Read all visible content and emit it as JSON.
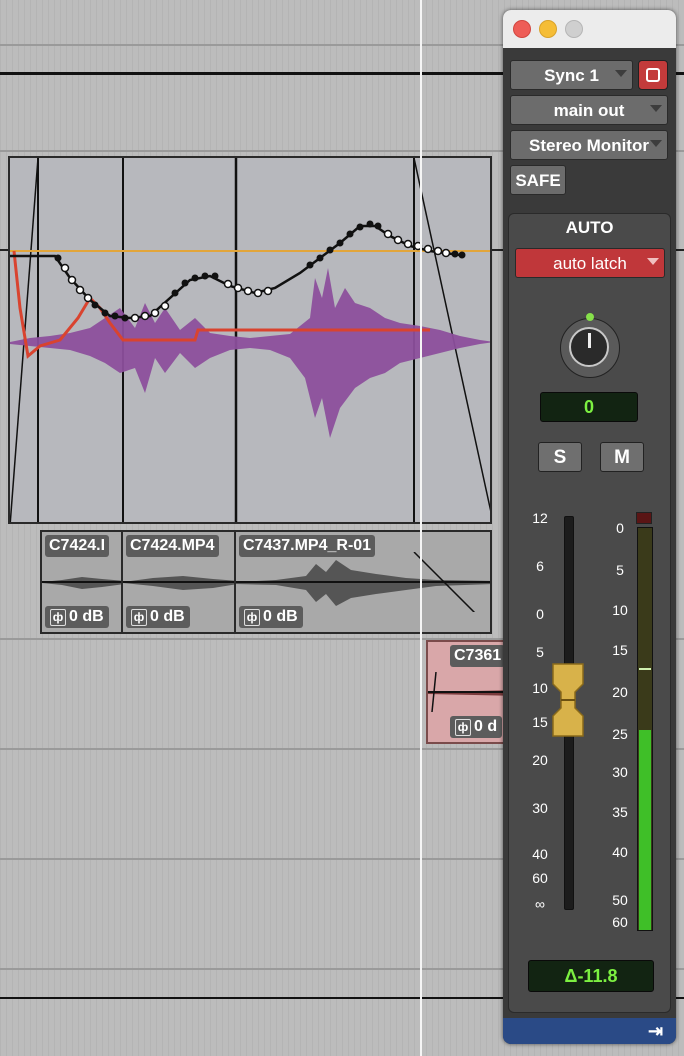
{
  "timeline": {
    "clips": [
      {
        "name": "C7424.I",
        "gain": "0 dB"
      },
      {
        "name": "C7424.MP4",
        "gain": "0 dB"
      },
      {
        "name": "C7437.MP4_R-01",
        "gain": "0 dB"
      },
      {
        "name": "C7361",
        "gain": "0 d"
      }
    ]
  },
  "window": {
    "sync_label": "Sync 1",
    "output_label": "main out",
    "monitor_label": "Stereo Monitor",
    "safe_label": "SAFE",
    "auto_header": "AUTO",
    "automation_mode": "auto latch",
    "pan_value": "0",
    "solo_label": "S",
    "mute_label": "M",
    "fader_scale": [
      "12",
      "6",
      "0",
      "5",
      "10",
      "15",
      "20",
      "30",
      "40",
      "60",
      "∞"
    ],
    "meter_scale": [
      "0",
      "5",
      "10",
      "15",
      "20",
      "25",
      "30",
      "35",
      "40",
      "50",
      "60"
    ],
    "volume_readout": "Δ-11.8",
    "fader_level_db": -11.8,
    "colors": {
      "automation_mode_bg": "#c0373a",
      "lcd_text": "#7cf041",
      "meter_green": "#3fbf28",
      "fader_cap": "#d8b24a",
      "bottom_bar": "#2a4a86"
    },
    "icons": [
      "close-light",
      "minimize-light",
      "zoom-light",
      "target-icon",
      "output-arrow-icon"
    ]
  }
}
